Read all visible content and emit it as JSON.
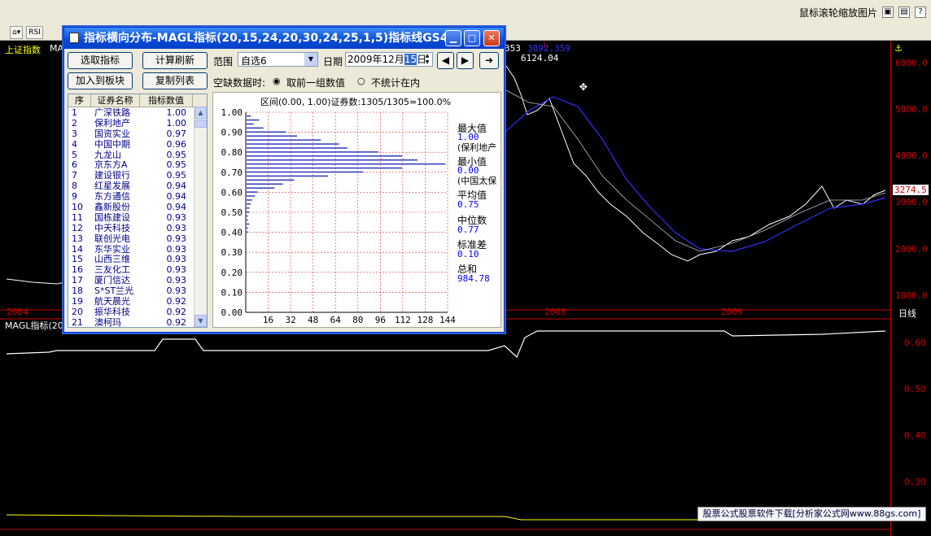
{
  "header": {
    "zoom_hint": "鼠标滚轮缩放图片"
  },
  "toolbar": {
    "rsi_label": "RSI"
  },
  "main_chart": {
    "index_name": "上证指数",
    "ma_label": "MA-",
    "y_ticks": [
      "6000.0",
      "5000.0",
      "4000.0",
      "3000.0",
      "2000.0",
      "1000.0"
    ],
    "current_price": "3274.5",
    "peak_label": "6124.04",
    "ma_readout": "353",
    "ma_value": "3092.359",
    "x_ticks": [
      "2004",
      "2008",
      "2009"
    ],
    "period": "日线"
  },
  "sub_chart": {
    "title": "MAGL指标(20,",
    "y_ticks": [
      "0.60",
      "0.50",
      "0.40",
      "0.30"
    ]
  },
  "dialog": {
    "title": "指标横向分布-MAGL指标(20,15,24,20,30,24,25,1,5)指标线GS4...",
    "buttons": {
      "select_indicator": "选取指标",
      "calc_refresh": "计算刷新",
      "add_to_block": "加入到板块",
      "copy_list": "复制列表"
    },
    "range_label": "范围",
    "range_value": "自选6",
    "date_label": "日期",
    "date_value": "2009年12月",
    "date_day": "15",
    "date_suffix": "日",
    "missing_label": "空缺数据时:",
    "missing_opt1": "取前一组数值",
    "missing_opt2": "不统计在内",
    "columns": [
      "序",
      "证券名称",
      "指标数值"
    ],
    "rows": [
      [
        "1",
        "广深铁路",
        "1.00"
      ],
      [
        "2",
        "保利地产",
        "1.00"
      ],
      [
        "3",
        "国资实业",
        "0.97"
      ],
      [
        "4",
        "中国中期",
        "0.96"
      ],
      [
        "5",
        "九龙山",
        "0.95"
      ],
      [
        "6",
        "京东方A",
        "0.95"
      ],
      [
        "7",
        "建设银行",
        "0.95"
      ],
      [
        "8",
        "红星发展",
        "0.94"
      ],
      [
        "9",
        "东方通信",
        "0.94"
      ],
      [
        "10",
        "鑫新股份",
        "0.94"
      ],
      [
        "11",
        "国栋建设",
        "0.93"
      ],
      [
        "12",
        "中天科技",
        "0.93"
      ],
      [
        "13",
        "联创光电",
        "0.93"
      ],
      [
        "14",
        "东华实业",
        "0.93"
      ],
      [
        "15",
        "山西三维",
        "0.93"
      ],
      [
        "16",
        "三友化工",
        "0.93"
      ],
      [
        "17",
        "厦门信达",
        "0.93"
      ],
      [
        "18",
        "S*ST兰光",
        "0.93"
      ],
      [
        "19",
        "航天晨光",
        "0.92"
      ],
      [
        "20",
        "振华科技",
        "0.92"
      ],
      [
        "21",
        "澳柯玛",
        "0.92"
      ]
    ],
    "hist_title": "区间(0.00, 1.00)证券数:1305/1305=100.0%",
    "stats": {
      "max_label": "最大值",
      "max_value": "1.00",
      "max_name": "(保利地产",
      "min_label": "最小值",
      "min_value": "0.00",
      "min_name": "(中国太保",
      "avg_label": "平均值",
      "avg_value": "0.75",
      "median_label": "中位数",
      "median_value": "0.77",
      "std_label": "标准差",
      "std_value": "0.10",
      "sum_label": "总和",
      "sum_value": "984.78"
    }
  },
  "chart_data": {
    "type": "bar",
    "orientation": "horizontal",
    "y_ticks": [
      "1.00",
      "0.90",
      "0.80",
      "0.70",
      "0.60",
      "0.50",
      "0.40",
      "0.30",
      "0.20",
      "0.10",
      "0.00"
    ],
    "x_ticks": [
      "16",
      "32",
      "48",
      "64",
      "80",
      "96",
      "112",
      "128",
      "144"
    ],
    "xlim": [
      0,
      144
    ],
    "ylim": [
      0,
      1
    ],
    "bins": [
      {
        "y": 0.98,
        "count": 3
      },
      {
        "y": 0.96,
        "count": 9
      },
      {
        "y": 0.94,
        "count": 5
      },
      {
        "y": 0.92,
        "count": 12
      },
      {
        "y": 0.9,
        "count": 28
      },
      {
        "y": 0.88,
        "count": 36
      },
      {
        "y": 0.86,
        "count": 53
      },
      {
        "y": 0.84,
        "count": 66
      },
      {
        "y": 0.82,
        "count": 72
      },
      {
        "y": 0.8,
        "count": 94
      },
      {
        "y": 0.78,
        "count": 111
      },
      {
        "y": 0.76,
        "count": 122
      },
      {
        "y": 0.74,
        "count": 142
      },
      {
        "y": 0.72,
        "count": 111
      },
      {
        "y": 0.7,
        "count": 83
      },
      {
        "y": 0.68,
        "count": 58
      },
      {
        "y": 0.66,
        "count": 34
      },
      {
        "y": 0.64,
        "count": 26
      },
      {
        "y": 0.62,
        "count": 20
      },
      {
        "y": 0.6,
        "count": 8
      },
      {
        "y": 0.58,
        "count": 6
      },
      {
        "y": 0.56,
        "count": 4
      },
      {
        "y": 0.54,
        "count": 3
      },
      {
        "y": 0.52,
        "count": 2
      },
      {
        "y": 0.5,
        "count": 2
      },
      {
        "y": 0.48,
        "count": 1
      },
      {
        "y": 0.46,
        "count": 1
      },
      {
        "y": 0.44,
        "count": 2
      },
      {
        "y": 0.42,
        "count": 1
      },
      {
        "y": 0.4,
        "count": 1
      }
    ]
  },
  "watermark": "股票公式股票软件下载[分析家公式网www.88gs.com]"
}
